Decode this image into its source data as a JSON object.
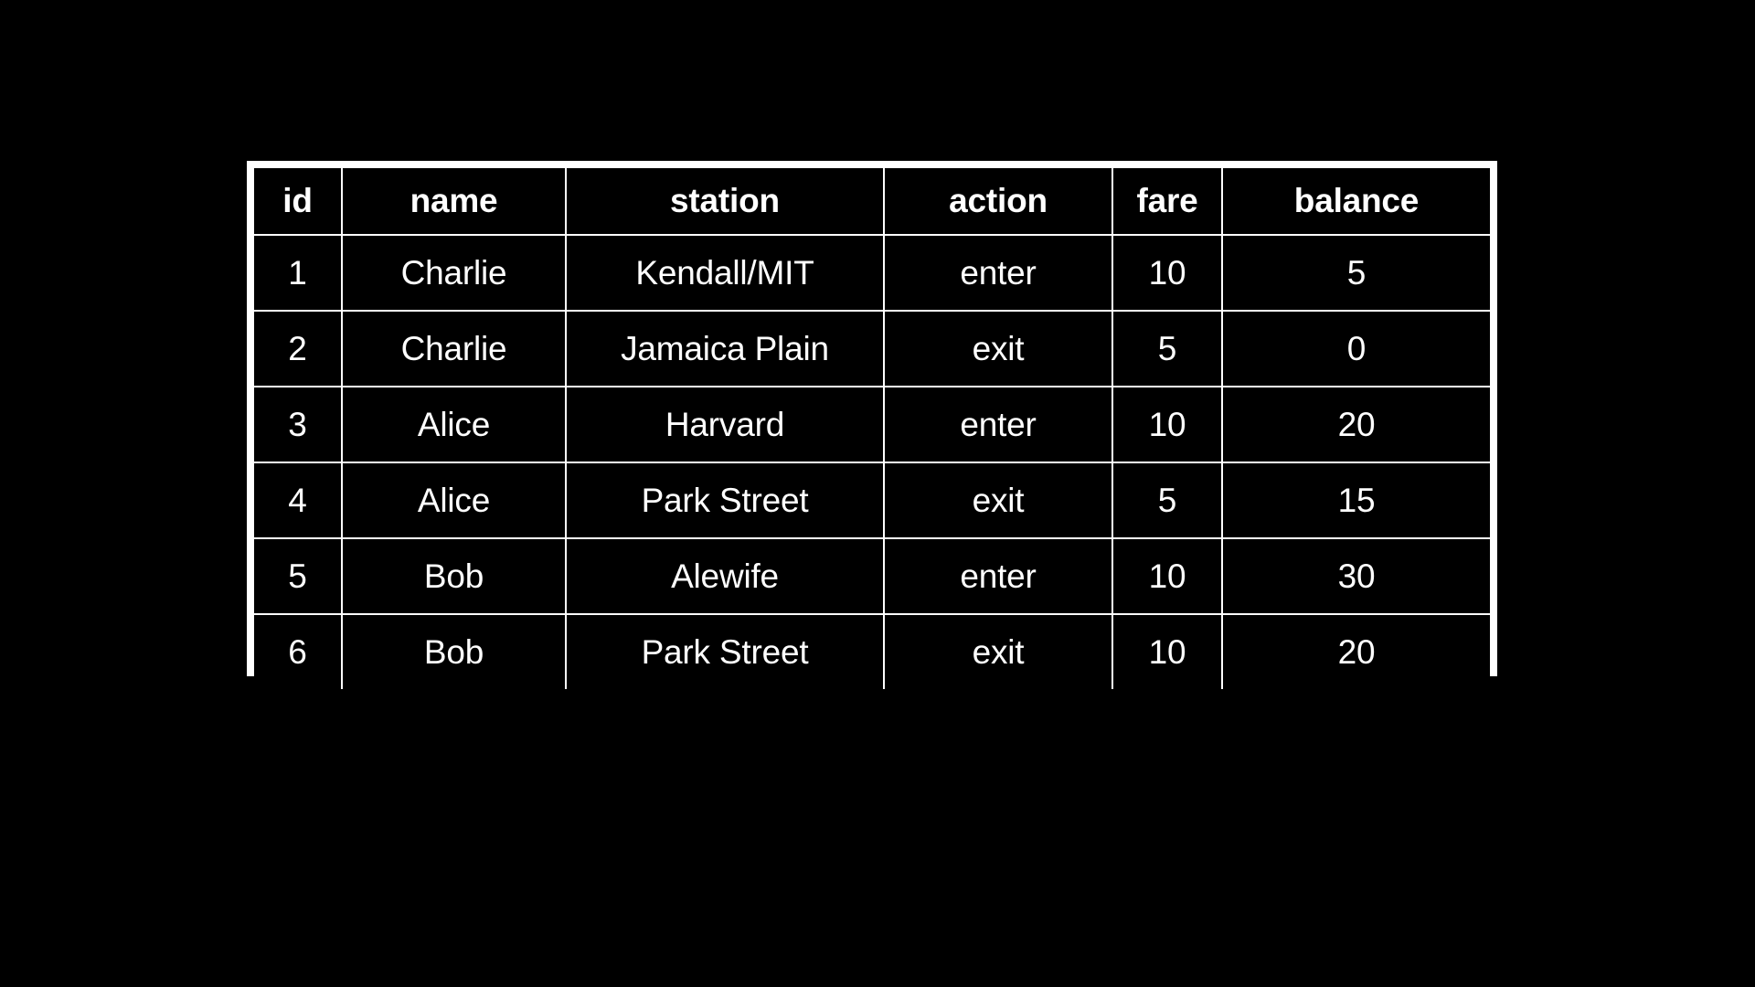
{
  "page": {
    "background_color": "#000000",
    "text_color": "#ffffff",
    "border_color": "#ffffff"
  },
  "table": {
    "name": "transit-fare-log-table",
    "columns": [
      {
        "key": "id",
        "label": "id"
      },
      {
        "key": "name",
        "label": "name"
      },
      {
        "key": "station",
        "label": "station"
      },
      {
        "key": "action",
        "label": "action"
      },
      {
        "key": "fare",
        "label": "fare"
      },
      {
        "key": "balance",
        "label": "balance"
      }
    ],
    "rows": [
      {
        "id": "1",
        "name": "Charlie",
        "station": "Kendall/MIT",
        "action": "enter",
        "fare": "10",
        "balance": "5"
      },
      {
        "id": "2",
        "name": "Charlie",
        "station": "Jamaica Plain",
        "action": "exit",
        "fare": "5",
        "balance": "0"
      },
      {
        "id": "3",
        "name": "Alice",
        "station": "Harvard",
        "action": "enter",
        "fare": "10",
        "balance": "20"
      },
      {
        "id": "4",
        "name": "Alice",
        "station": "Park Street",
        "action": "exit",
        "fare": "5",
        "balance": "15"
      },
      {
        "id": "5",
        "name": "Bob",
        "station": "Alewife",
        "action": "enter",
        "fare": "10",
        "balance": "30"
      },
      {
        "id": "6",
        "name": "Bob",
        "station": "Park Street",
        "action": "exit",
        "fare": "10",
        "balance": "20"
      }
    ]
  }
}
